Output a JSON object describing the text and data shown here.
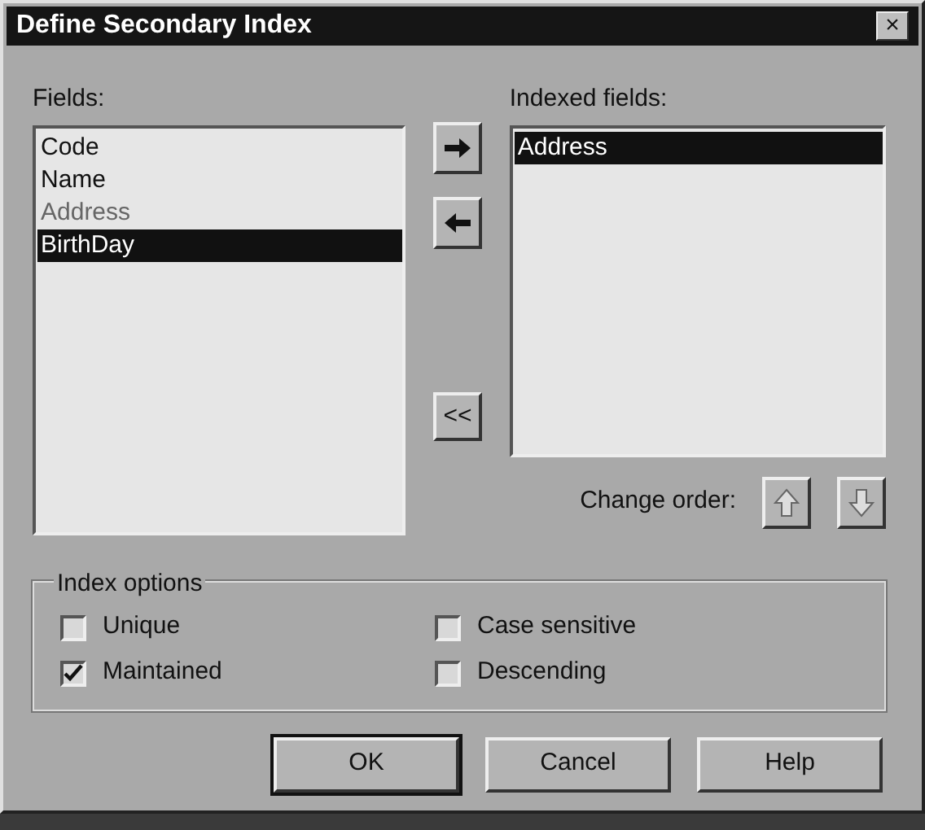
{
  "window": {
    "title": "Define Secondary Index",
    "close": "×"
  },
  "fields": {
    "label": "Fields:",
    "items": [
      {
        "text": "Code",
        "selected": false,
        "disabled": false
      },
      {
        "text": "Name",
        "selected": false,
        "disabled": false
      },
      {
        "text": "Address",
        "selected": false,
        "disabled": true
      },
      {
        "text": "BirthDay",
        "selected": true,
        "disabled": false
      }
    ]
  },
  "move_buttons": [
    {
      "kind": "add"
    },
    {
      "kind": "remove"
    },
    {
      "kind": "remove_all",
      "text": "<<"
    }
  ],
  "indexed_fields": {
    "label": "Indexed fields:",
    "items": [
      {
        "text": "Address",
        "selected": true
      }
    ]
  },
  "change_order": {
    "label": "Change order:",
    "buttons": [
      {
        "kind": "up",
        "disabled": true
      },
      {
        "kind": "down",
        "disabled": true
      }
    ]
  },
  "index_options": {
    "title": "Index options",
    "options": [
      {
        "label": "Unique",
        "checked": false
      },
      {
        "label": "Case sensitive",
        "checked": false
      },
      {
        "label": "Maintained",
        "checked": true
      },
      {
        "label": "Descending",
        "checked": false
      }
    ]
  },
  "buttons": [
    {
      "text": "OK",
      "default": true
    },
    {
      "text": "Cancel",
      "default": false
    },
    {
      "text": "Help",
      "default": false
    }
  ]
}
